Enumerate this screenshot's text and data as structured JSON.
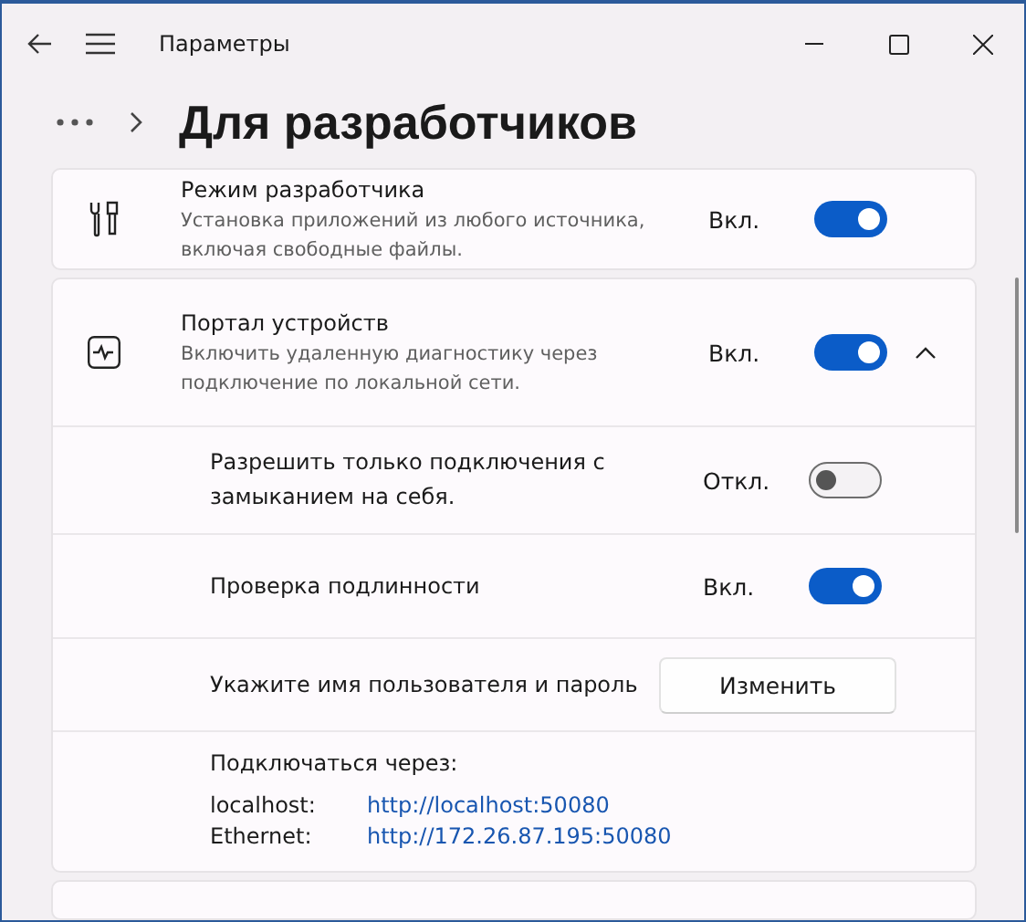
{
  "window": {
    "title": "Параметры"
  },
  "page": {
    "title": "Для разработчиков"
  },
  "developer_mode": {
    "title": "Режим разработчика",
    "description": "Установка приложений из любого источника, включая свободные файлы.",
    "state_label": "Вкл.",
    "on": true
  },
  "device_portal": {
    "title": "Портал устройств",
    "description": "Включить удаленную диагностику через подключение по локальной сети.",
    "state_label": "Вкл.",
    "on": true,
    "expanded": true,
    "rows": [
      {
        "kind": "toggle",
        "label": "Разрешить только подключения с замыканием на себя.",
        "state_label": "Откл.",
        "on": false
      },
      {
        "kind": "toggle",
        "label": "Проверка подлинности",
        "state_label": "Вкл.",
        "on": true
      },
      {
        "kind": "button",
        "label": "Укажите имя пользователя и пароль",
        "button": "Изменить"
      }
    ],
    "connect": {
      "heading": "Подключаться через:",
      "links": [
        {
          "name": "localhost:",
          "url": "http://localhost:50080"
        },
        {
          "name": "Ethernet:",
          "url": "http://172.26.87.195:50080"
        }
      ]
    }
  }
}
